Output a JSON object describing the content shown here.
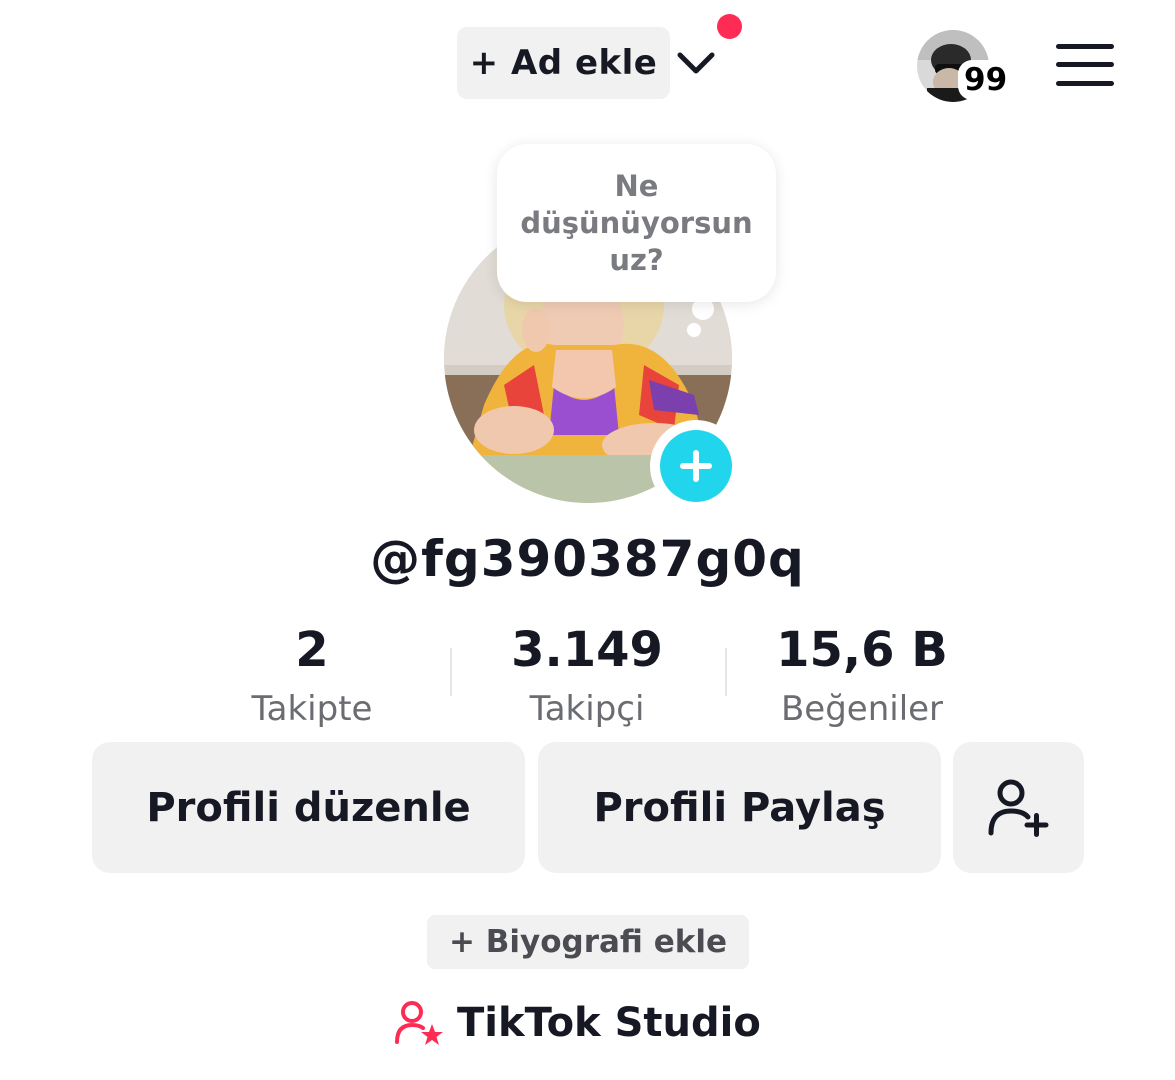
{
  "header": {
    "add_account_label": "+ Ad ekle",
    "badge_count": "99",
    "accent_color": "#fe2c55"
  },
  "profile": {
    "thought_bubble": "Ne düşünüyorsun uz?",
    "username": "@fg390387g0q"
  },
  "stats": [
    {
      "value": "2",
      "label": "Takipte"
    },
    {
      "value": "3.149",
      "label": "Takipçi"
    },
    {
      "value": "15,6 B",
      "label": "Beğeniler"
    }
  ],
  "actions": {
    "edit_profile": "Profili düzenle",
    "share_profile": "Profili Paylaş",
    "add_friend_icon": "add-user-icon"
  },
  "bio": {
    "add_bio_label": "+ Biyografi ekle"
  },
  "studio": {
    "label": "TikTok Studio",
    "icon": "creator-star-icon"
  }
}
